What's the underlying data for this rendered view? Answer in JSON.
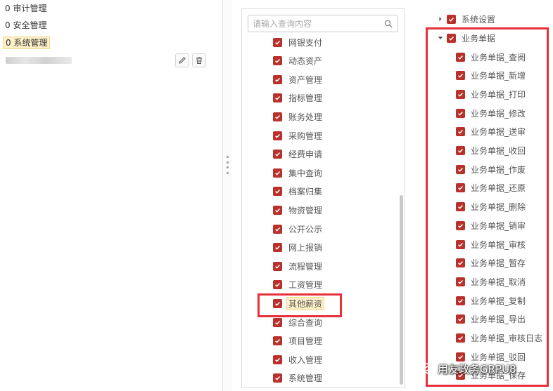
{
  "left_panel": {
    "roles": [
      {
        "label": "0 审计管理"
      },
      {
        "label": "0 安全管理"
      },
      {
        "label": "0 系统管理",
        "selected": true
      }
    ],
    "edit_icon": "pencil-icon",
    "delete_icon": "trash-icon"
  },
  "middle_panel": {
    "search_placeholder": "请输入查询内容",
    "items": [
      "网银支付",
      "动态资产",
      "资产管理",
      "指标管理",
      "账务处理",
      "采购管理",
      "经费申请",
      "集中查询",
      "档案归集",
      "物资管理",
      "公开公示",
      "网上报销",
      "流程管理",
      "工资管理",
      "其他薪资",
      "综合查询",
      "项目管理",
      "收入管理",
      "系统管理"
    ],
    "highlighted_item": "其他薪资"
  },
  "right_panel": {
    "system_settings": "系统设置",
    "business_docs": "业务单据",
    "children": [
      "业务单据_查阅",
      "业务单据_新增",
      "业务单据_打印",
      "业务单据_修改",
      "业务单据_送审",
      "业务单据_收回",
      "业务单据_作废",
      "业务单据_还原",
      "业务单据_删除",
      "业务单据_销审",
      "业务单据_审核",
      "业务单据_暂存",
      "业务单据_取消",
      "业务单据_复制",
      "业务单据_导出",
      "业务单据_审核日志",
      "业务单据_驳回",
      "业务单据_保存"
    ]
  },
  "watermark": "用友政务GRPU8",
  "colors": {
    "checkbox": "#b9312b",
    "highlight_box": "#e8303a",
    "selected_bg": "#fdf0c8"
  }
}
